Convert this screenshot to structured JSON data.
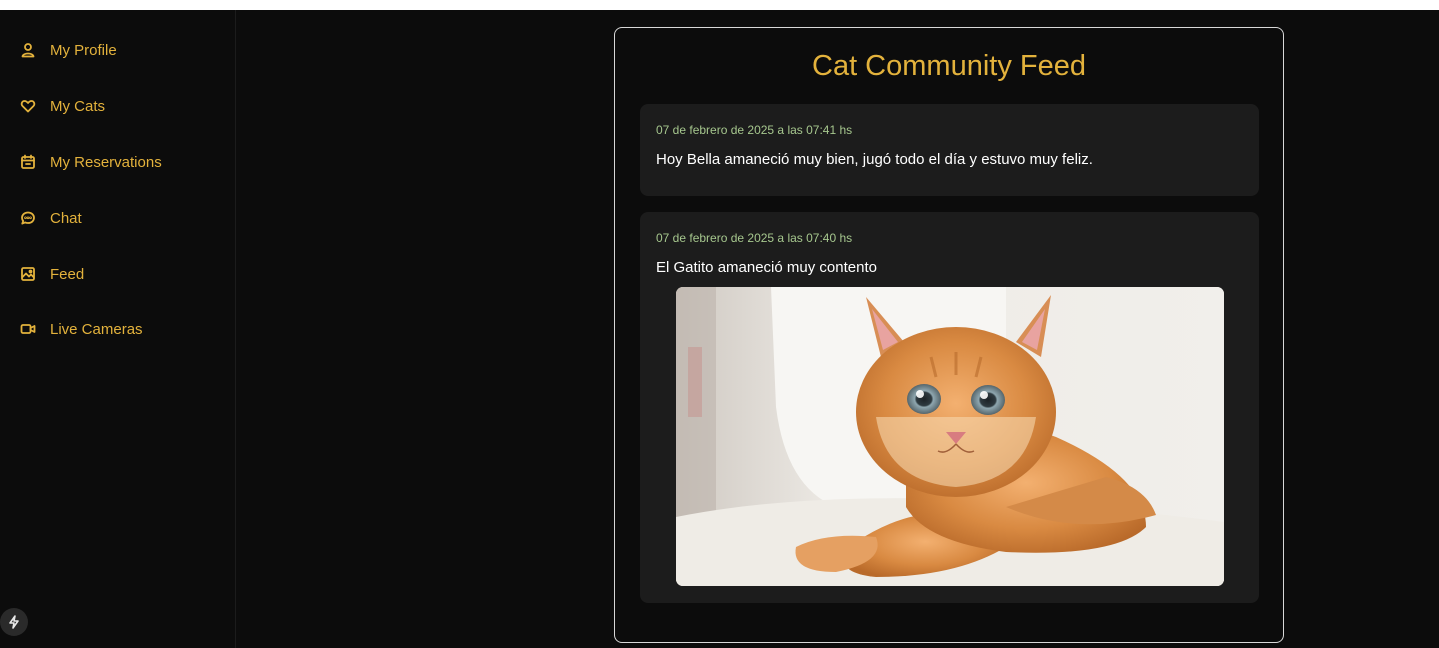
{
  "sidebar": {
    "items": [
      {
        "label": "My Profile",
        "icon": "user-icon"
      },
      {
        "label": "My Cats",
        "icon": "heart-icon"
      },
      {
        "label": "My Reservations",
        "icon": "calendar-icon"
      },
      {
        "label": "Chat",
        "icon": "chat-bubble-icon"
      },
      {
        "label": "Feed",
        "icon": "image-icon"
      },
      {
        "label": "Live Cameras",
        "icon": "video-camera-icon"
      }
    ]
  },
  "feed": {
    "title": "Cat Community Feed",
    "posts": [
      {
        "timestamp": "07 de febrero de 2025 a las 07:41 hs",
        "text": "Hoy Bella amaneció muy bien, jugó todo el día y estuvo muy feliz."
      },
      {
        "timestamp": "07 de febrero de 2025 a las 07:40 hs",
        "text": "El Gatito amaneció muy contento",
        "image": "orange-kitten-photo"
      }
    ]
  },
  "colors": {
    "accent": "#e3b23c",
    "background": "#0c0c0c",
    "card": "#1c1c1c",
    "timestamp": "#a6c78e",
    "text": "#ffffff"
  }
}
